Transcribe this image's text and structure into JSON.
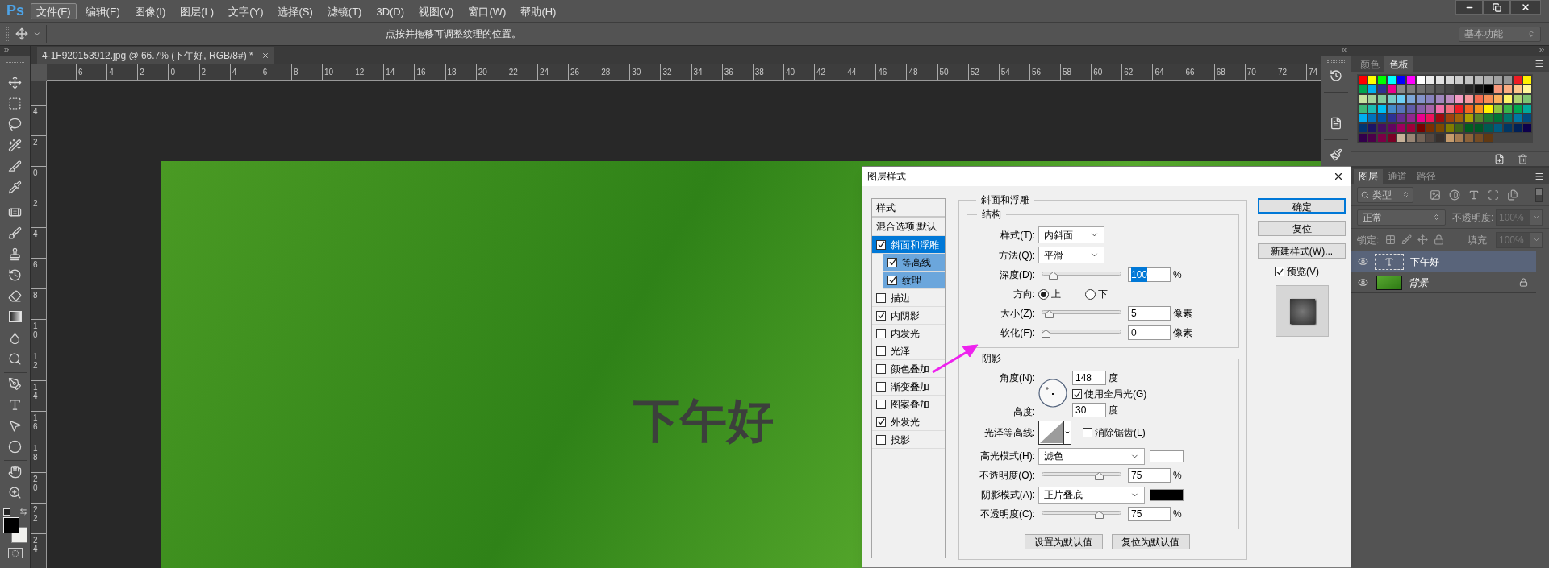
{
  "menu_bar": {
    "logo": "Ps",
    "items": [
      {
        "label": "文件(F)",
        "selected": true
      },
      {
        "label": "编辑(E)",
        "selected": false
      },
      {
        "label": "图像(I)",
        "selected": false
      },
      {
        "label": "图层(L)",
        "selected": false
      },
      {
        "label": "文字(Y)",
        "selected": false
      },
      {
        "label": "选择(S)",
        "selected": false
      },
      {
        "label": "滤镜(T)",
        "selected": false
      },
      {
        "label": "3D(D)",
        "selected": false
      },
      {
        "label": "视图(V)",
        "selected": false
      },
      {
        "label": "窗口(W)",
        "selected": false
      },
      {
        "label": "帮助(H)",
        "selected": false
      }
    ]
  },
  "options_bar": {
    "hint": "点按并拖移可调整纹理的位置。",
    "workspace": "基本功能"
  },
  "document": {
    "tab_title": "4-1F920153912.jpg @ 66.7% (下午好, RGB/8#) *",
    "ruler_h": [
      "6",
      "4",
      "2",
      "0",
      "2",
      "4",
      "6",
      "8",
      "10",
      "12",
      "14",
      "16",
      "18",
      "20",
      "22",
      "24",
      "26",
      "28",
      "30",
      "32",
      "34",
      "36",
      "38",
      "40",
      "42",
      "44",
      "46",
      "48",
      "50",
      "52",
      "54",
      "56",
      "58",
      "60",
      "62",
      "64",
      "66",
      "68",
      "70",
      "72",
      "74"
    ],
    "ruler_v": [
      "4",
      "2",
      "0",
      "2",
      "4",
      "6",
      "8",
      "10",
      "12",
      "14",
      "16",
      "18",
      "20",
      "22",
      "24"
    ],
    "canvas_text": "下午好"
  },
  "swatches_panel": {
    "tabs": [
      {
        "label": "颜色",
        "selected": false
      },
      {
        "label": "色板",
        "selected": true
      }
    ],
    "rows": [
      {
        "swatches": [
          {
            "color": "#ff0000"
          },
          {
            "color": "#ffff00"
          },
          {
            "color": "#00ff00"
          },
          {
            "color": "#00ffff"
          },
          {
            "color": "#0000ff"
          },
          {
            "color": "#ff00ff"
          },
          {
            "color": "#ffffff"
          },
          {
            "color": "#ebebeb"
          },
          {
            "color": "#e1e1e1"
          },
          {
            "color": "#d7d7d7"
          },
          {
            "color": "#cccccc"
          },
          {
            "color": "#c2c2c2"
          },
          {
            "color": "#b7b7b7"
          },
          {
            "color": "#acacac"
          },
          {
            "color": "#a0a0a0"
          },
          {
            "color": "#959595"
          },
          {
            "color": "#ee1d24"
          },
          {
            "color": "#fff100"
          }
        ]
      },
      {
        "swatches": [
          {
            "color": "#00a650"
          },
          {
            "color": "#00aeef"
          },
          {
            "color": "#2e3192"
          },
          {
            "color": "#ec008c"
          },
          {
            "color": "#898989"
          },
          {
            "color": "#7d7d7d"
          },
          {
            "color": "#707070"
          },
          {
            "color": "#636363"
          },
          {
            "color": "#555555"
          },
          {
            "color": "#464646"
          },
          {
            "color": "#363636"
          },
          {
            "color": "#252525"
          },
          {
            "color": "#111111"
          },
          {
            "color": "#000000"
          },
          {
            "color": "#f7977a"
          },
          {
            "color": "#fbad82"
          },
          {
            "color": "#fdc68c"
          },
          {
            "color": "#fff799"
          }
        ]
      },
      {
        "swatches": [
          {
            "color": "#c7e2a0"
          },
          {
            "color": "#a3d39c"
          },
          {
            "color": "#82ca9c"
          },
          {
            "color": "#7accc8"
          },
          {
            "color": "#6dcff6"
          },
          {
            "color": "#7da7d8"
          },
          {
            "color": "#8493ca"
          },
          {
            "color": "#8882be"
          },
          {
            "color": "#a187be"
          },
          {
            "color": "#bc8cbf"
          },
          {
            "color": "#f49ac2"
          },
          {
            "color": "#f6989d"
          },
          {
            "color": "#f26c4f"
          },
          {
            "color": "#f68e56"
          },
          {
            "color": "#fbaf5c"
          },
          {
            "color": "#fff467"
          },
          {
            "color": "#acd372"
          },
          {
            "color": "#7dc473"
          }
        ]
      },
      {
        "swatches": [
          {
            "color": "#3cb878"
          },
          {
            "color": "#1abbb4"
          },
          {
            "color": "#00bff3"
          },
          {
            "color": "#438ccb"
          },
          {
            "color": "#5574b9"
          },
          {
            "color": "#605ca8"
          },
          {
            "color": "#855fa8"
          },
          {
            "color": "#a864a8"
          },
          {
            "color": "#f06ea9"
          },
          {
            "color": "#f26d7d"
          },
          {
            "color": "#ed1c24"
          },
          {
            "color": "#f26522"
          },
          {
            "color": "#f7941d"
          },
          {
            "color": "#fff200"
          },
          {
            "color": "#8dc63f"
          },
          {
            "color": "#39b54a"
          },
          {
            "color": "#00a651"
          },
          {
            "color": "#00a99d"
          }
        ]
      },
      {
        "swatches": [
          {
            "color": "#00aef0"
          },
          {
            "color": "#0072bc"
          },
          {
            "color": "#0054a6"
          },
          {
            "color": "#2e3193"
          },
          {
            "color": "#662d91"
          },
          {
            "color": "#92278f"
          },
          {
            "color": "#ec008d"
          },
          {
            "color": "#ed145b"
          },
          {
            "color": "#9e0b0f"
          },
          {
            "color": "#a0410d"
          },
          {
            "color": "#a36209"
          },
          {
            "color": "#aba000"
          },
          {
            "color": "#598527"
          },
          {
            "color": "#197b30"
          },
          {
            "color": "#007236"
          },
          {
            "color": "#00746b"
          },
          {
            "color": "#0076a3"
          },
          {
            "color": "#004a80"
          }
        ]
      },
      {
        "swatches": [
          {
            "color": "#003471"
          },
          {
            "color": "#1b1464"
          },
          {
            "color": "#440e62"
          },
          {
            "color": "#630460"
          },
          {
            "color": "#9e005d"
          },
          {
            "color": "#9e0039"
          },
          {
            "color": "#790000"
          },
          {
            "color": "#7b2e00"
          },
          {
            "color": "#7d4900"
          },
          {
            "color": "#827b00"
          },
          {
            "color": "#406618"
          },
          {
            "color": "#005e20"
          },
          {
            "color": "#005826"
          },
          {
            "color": "#005952"
          },
          {
            "color": "#005b7f"
          },
          {
            "color": "#003663"
          },
          {
            "color": "#002157"
          },
          {
            "color": "#0d004c"
          }
        ]
      },
      {
        "swatches": [
          {
            "color": "#32004b"
          },
          {
            "color": "#4b0049"
          },
          {
            "color": "#7b0046"
          },
          {
            "color": "#7a0026"
          },
          {
            "color": "#c7b299"
          },
          {
            "color": "#998675"
          },
          {
            "color": "#736357"
          },
          {
            "color": "#534741"
          },
          {
            "color": "#37302d"
          },
          {
            "color": "#c69c6d"
          },
          {
            "color": "#a67c52"
          },
          {
            "color": "#8c6239"
          },
          {
            "color": "#754c24"
          },
          {
            "color": "#603913"
          }
        ]
      }
    ]
  },
  "layers_panel": {
    "tabs": [
      {
        "label": "图层",
        "selected": true
      },
      {
        "label": "通道",
        "selected": false
      },
      {
        "label": "路径",
        "selected": false
      }
    ],
    "filter": "类型",
    "blend_mode": "正常",
    "opacity_label": "不透明度:",
    "opacity": "100%",
    "lock_label": "锁定:",
    "fill_label": "填充:",
    "fill": "100%",
    "layers": [
      {
        "name": "下午好",
        "kind": "text",
        "selected": true,
        "visible": true,
        "locked": false
      },
      {
        "name": "背景",
        "kind": "image",
        "selected": false,
        "visible": true,
        "locked": true
      }
    ]
  },
  "dialog": {
    "title": "图层样式",
    "styles_header": "样式",
    "blending": "混合选项:默认",
    "effects": [
      {
        "label": "斜面和浮雕",
        "checked": true,
        "selected": true,
        "children": [
          {
            "label": "等高线",
            "checked": true,
            "selected": false
          },
          {
            "label": "纹理",
            "checked": true,
            "selected": false
          }
        ]
      },
      {
        "label": "描边",
        "checked": false,
        "selected": false
      },
      {
        "label": "内阴影",
        "checked": true,
        "selected": false
      },
      {
        "label": "内发光",
        "checked": false,
        "selected": false
      },
      {
        "label": "光泽",
        "checked": false,
        "selected": false
      },
      {
        "label": "颜色叠加",
        "checked": false,
        "selected": false
      },
      {
        "label": "渐变叠加",
        "checked": false,
        "selected": false
      },
      {
        "label": "图案叠加",
        "checked": false,
        "selected": false
      },
      {
        "label": "外发光",
        "checked": true,
        "selected": false
      },
      {
        "label": "投影",
        "checked": false,
        "selected": false
      }
    ],
    "section_title": "斜面和浮雕",
    "structure": {
      "title": "结构",
      "rows": [
        {
          "kind": "dropdown",
          "label": "样式(T):",
          "value": "内斜面"
        },
        {
          "kind": "dropdown",
          "label": "方法(Q):",
          "value": "平滑"
        },
        {
          "kind": "slider",
          "label": "深度(D):",
          "level": 0.1,
          "value": "100",
          "unit": "%",
          "text_selected": true
        },
        {
          "kind": "radio",
          "label": "方向:",
          "options": [
            {
              "label": "上",
              "selected": true
            },
            {
              "label": "下",
              "selected": false
            }
          ]
        },
        {
          "kind": "slider",
          "label": "大小(Z):",
          "level": 0.05,
          "value": "5",
          "unit": "像素",
          "text_selected": false
        },
        {
          "kind": "slider",
          "label": "软化(F):",
          "level": 0,
          "value": "0",
          "unit": "像素",
          "text_selected": false
        }
      ]
    },
    "shading": {
      "title": "阴影",
      "angle": {
        "label": "角度(N):",
        "value": "148",
        "unit": "度"
      },
      "global_light": {
        "label": "使用全局光(G)",
        "checked": true
      },
      "altitude": {
        "label": "高度:",
        "value": "30",
        "unit": "度"
      },
      "gloss_label": "光泽等高线:",
      "anti_alias": {
        "label": "消除锯齿(L)",
        "checked": false
      },
      "rows": [
        {
          "kind": "mode",
          "label": "高光模式(H):",
          "value": "滤色",
          "color": "#ffffff"
        },
        {
          "kind": "slider",
          "label": "不透明度(O):",
          "level": 0.75,
          "value": "75",
          "unit": "%",
          "text_selected": false
        },
        {
          "kind": "mode",
          "label": "阴影模式(A):",
          "value": "正片叠底",
          "color": "#000000"
        },
        {
          "kind": "slider",
          "label": "不透明度(C):",
          "level": 0.75,
          "value": "75",
          "unit": "%",
          "text_selected": false
        }
      ]
    },
    "default_buttons": [
      "设置为默认值",
      "复位为默认值"
    ],
    "buttons": [
      {
        "label": "确定",
        "kind": "default"
      },
      {
        "label": "复位",
        "kind": "normal"
      },
      {
        "label": "新建样式(W)...",
        "kind": "normal"
      }
    ],
    "preview": {
      "label": "预览(V)",
      "checked": true
    }
  }
}
